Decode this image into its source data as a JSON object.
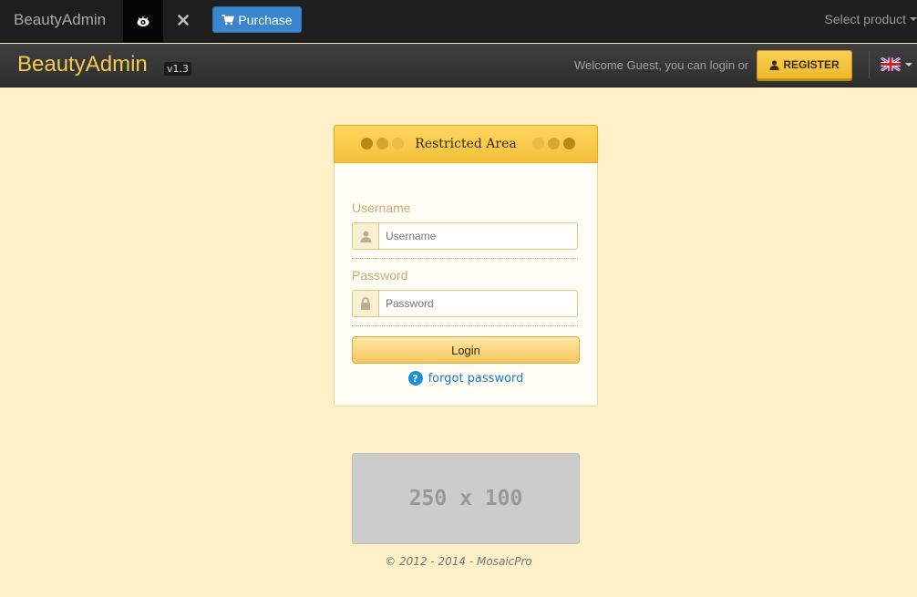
{
  "topbar": {
    "brand": "BeautyAdmin",
    "purchase_label": "Purchase",
    "select_product_label": "Select product"
  },
  "header": {
    "logo": "BeautyAdmin",
    "version": "v1.3",
    "welcome_text": "Welcome Guest, you can login or",
    "register_label": "REGISTER"
  },
  "login": {
    "title": "Restricted Area",
    "username_label": "Username",
    "username_placeholder": "Username",
    "password_label": "Password",
    "password_placeholder": "Password",
    "login_button": "Login",
    "forgot_link": "forgot password"
  },
  "ad": {
    "text": "250 x 100"
  },
  "footer": {
    "copyright": "© 2012 - 2014 - MosaicPro"
  },
  "icons": {
    "eye": "eye-icon",
    "close": "close-icon",
    "cart": "cart-icon",
    "user": "user-icon",
    "lock": "lock-icon",
    "flag": "uk-flag-icon",
    "help": "help-circle-icon"
  },
  "colors": {
    "accent": "#f6c03a",
    "page_bg": "#fff0c8",
    "link": "#1a7fc1",
    "purchase": "#3a85cd"
  }
}
